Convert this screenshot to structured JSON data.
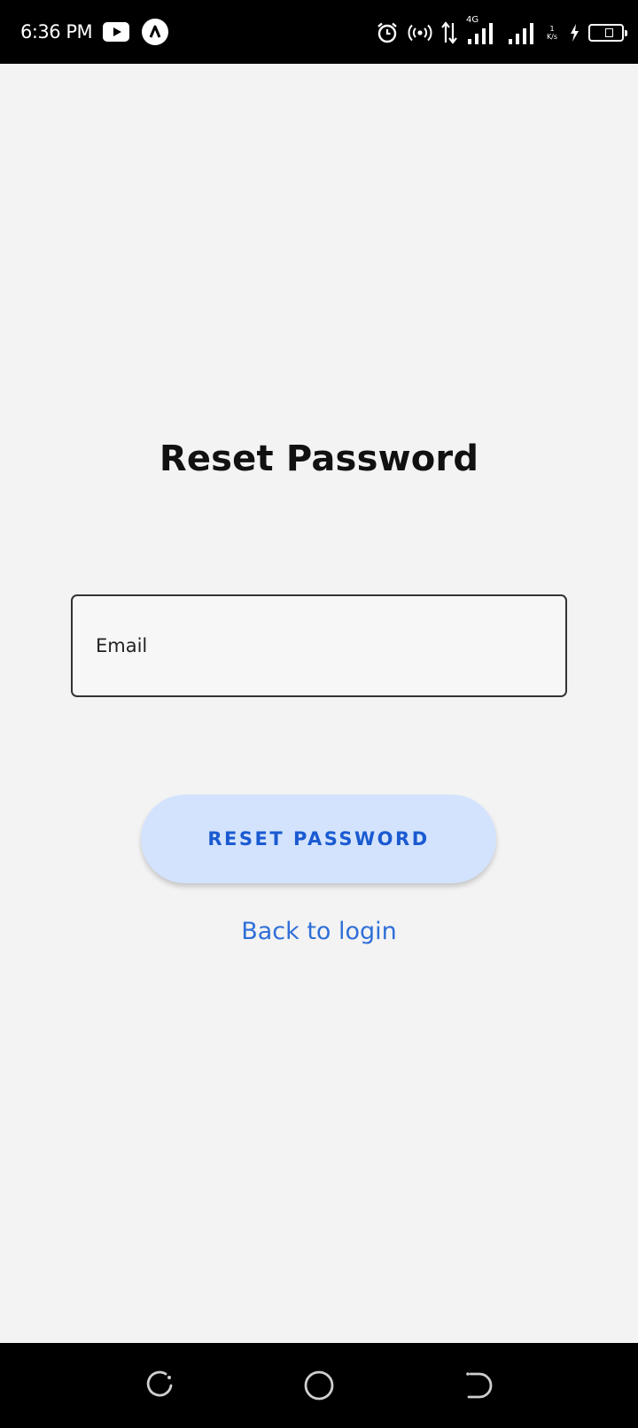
{
  "status_bar": {
    "time": "6:36 PM",
    "network_label": "4G",
    "speed_label_top": "1",
    "speed_label_bottom": "K/s",
    "icons": [
      "youtube-icon",
      "app-icon",
      "alarm-icon",
      "hotspot-icon",
      "data-transfer-icon",
      "signal-icon",
      "signal-icon",
      "charging-icon",
      "battery-icon"
    ]
  },
  "main": {
    "title": "Reset Password",
    "email_field": {
      "placeholder": "Email",
      "value": ""
    },
    "reset_button_label": "RESET PASSWORD",
    "back_link_label": "Back to login"
  },
  "colors": {
    "background": "#f3f3f3",
    "button_bg": "#d3e3fd",
    "button_text": "#1a5ad1",
    "link": "#2f6fd8",
    "bars": "#000000"
  },
  "nav_bar": {
    "icons": [
      "recents-icon",
      "home-icon",
      "back-icon"
    ]
  }
}
